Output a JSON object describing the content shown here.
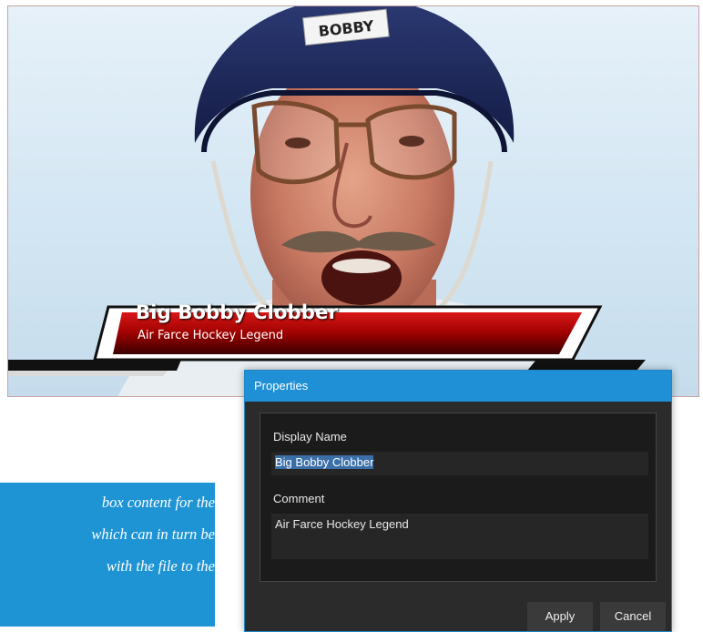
{
  "preview": {
    "helmet_text": "BOBBY",
    "lower_third": {
      "name": "Big Bobby Clobber",
      "subtitle": "Air Farce Hockey Legend"
    }
  },
  "caption": {
    "lines": [
      "box content for the",
      "which can in turn be",
      "with the file to the"
    ]
  },
  "dialog": {
    "title": "Properties",
    "display_name_label": "Display Name",
    "display_name_value": "Big Bobby Clobber",
    "comment_label": "Comment",
    "comment_value": "Air Farce Hockey Legend",
    "apply_label": "Apply",
    "cancel_label": "Cancel"
  },
  "colors": {
    "dialog_accent": "#1f8fd6",
    "caption_bg": "#1e94d4",
    "lower_third_red": "#b10000"
  }
}
